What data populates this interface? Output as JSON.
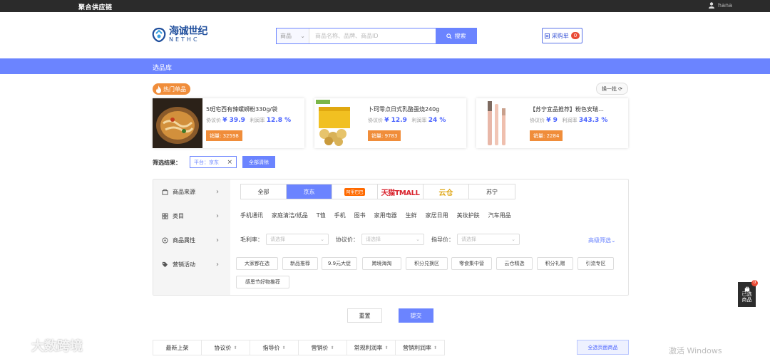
{
  "topbar": {
    "brand": "聚合供应链",
    "username": "hana"
  },
  "header": {
    "logo_cn": "海诚世纪",
    "logo_en": "NETHC",
    "search_select": "商品",
    "search_placeholder": "商品名称、品牌、商品ID",
    "search_button": "搜索",
    "cart_label": "采购单",
    "cart_count": "0"
  },
  "nav": {
    "item": "选品库"
  },
  "hot": {
    "tag": "热门单品",
    "refresh": "换一批",
    "products": [
      {
        "name": "5斑宅西有辣螺蛳粉330g/袋",
        "agreed_label": "协议价",
        "agreed": "¥ 39.9",
        "margin_label": "利润率",
        "margin": "12.8 %",
        "sales": "销量: 32598"
      },
      {
        "name": "卜珂零点日式乳酪蛋烧240g",
        "agreed_label": "协议价",
        "agreed": "¥ 12.9",
        "margin_label": "利润率",
        "margin": "24 %",
        "sales": "销量: 9783"
      },
      {
        "name": "【苏宁宜品推荐】粉色安瑞…",
        "agreed_label": "协议价",
        "agreed": "¥ 9",
        "margin_label": "利润率",
        "margin": "343.3 %",
        "sales": "销量: 2284"
      }
    ]
  },
  "filter_result": {
    "label": "筛选结果：",
    "tag": "平台：京东",
    "clear": "全部清除"
  },
  "side": [
    "商品来源",
    "类目",
    "商品属性",
    "营销活动"
  ],
  "platforms": [
    "全部",
    "京东",
    "阿里巴巴",
    "天猫TMALL",
    "云仓",
    "苏宁"
  ],
  "categories": [
    "手机通讯",
    "家庭清洁/纸品",
    "T恤",
    "手机",
    "图书",
    "家用电器",
    "生鲜",
    "家居日用",
    "美妆护肤",
    "汽车用品"
  ],
  "attrs": {
    "margin_label": "毛利率：",
    "agreed_label": "协议价：",
    "guide_label": "指导价：",
    "placeholder": "请选择",
    "advanced": "高级筛选"
  },
  "marketing": [
    "大家都在选",
    "新品推荐",
    "9.9元大促",
    "跨境海淘",
    "积分兑换区",
    "零食集中营",
    "云仓精选",
    "积分礼赠",
    "引流专区",
    "感恩节好物推荐"
  ],
  "actions": {
    "reset": "重置",
    "submit": "提交"
  },
  "sort": {
    "items": [
      "最新上架",
      "协议价",
      "指导价",
      "营销价",
      "常规利润率",
      "营销利润率"
    ],
    "select_all": "全选页面商品"
  },
  "floating": {
    "label1": "已选",
    "label2": "商品",
    "count": "0"
  },
  "watermark": "大数跨境",
  "os_overlay": "激活 Windows",
  "colors": {
    "accent": "#6b84ff",
    "hot": "#f08d3a",
    "price": "#4a63ff",
    "badge": "#e94a35"
  }
}
